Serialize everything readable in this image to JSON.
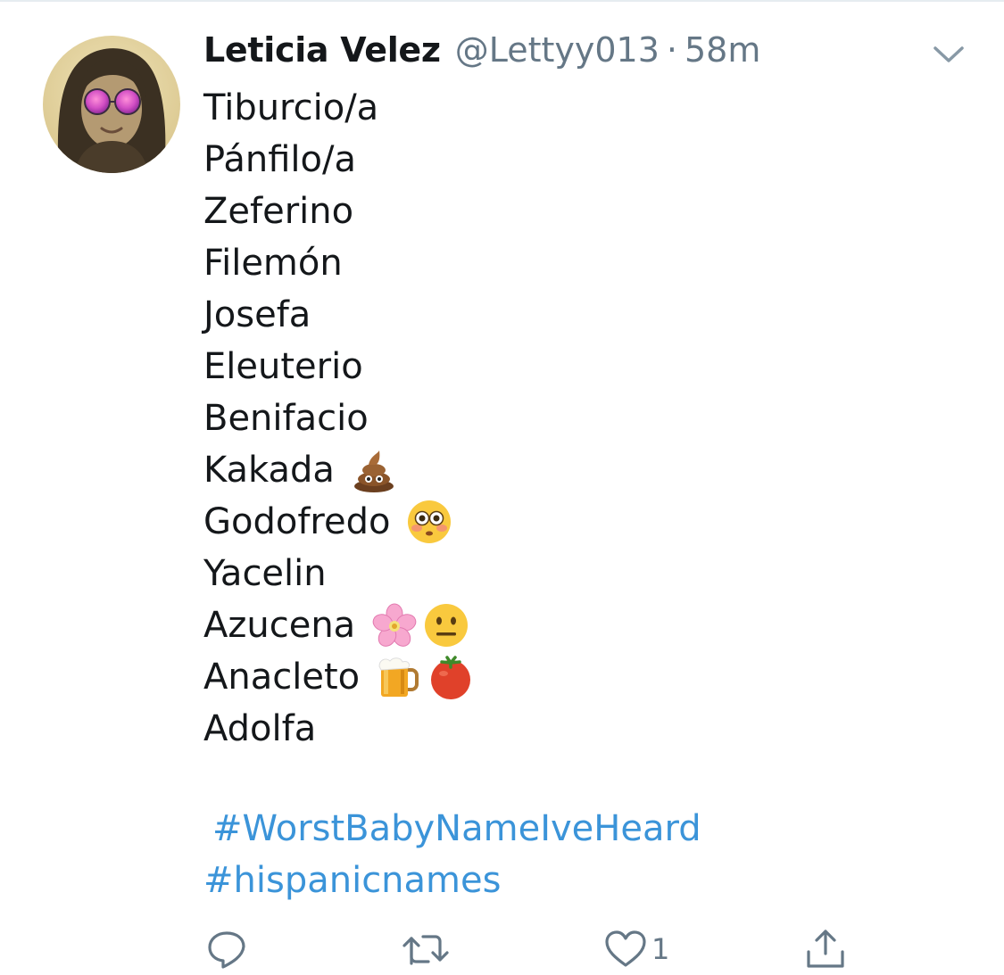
{
  "tweet": {
    "display_name": "Leticia Velez",
    "handle": "@Lettyy013",
    "separator": "·",
    "time": "58m",
    "avatar": "profile-photo-with-pink-round-sunglasses",
    "lines": [
      {
        "text": "Tiburcio/a",
        "emojis": []
      },
      {
        "text": "Pánfilo/a",
        "emojis": []
      },
      {
        "text": "Zeferino",
        "emojis": []
      },
      {
        "text": "Filemón",
        "emojis": []
      },
      {
        "text": "Josefa",
        "emojis": []
      },
      {
        "text": "Eleuterio",
        "emojis": []
      },
      {
        "text": "Benifacio",
        "emojis": []
      },
      {
        "text": "Kakada",
        "emojis": [
          "pile-of-poo-emoji"
        ]
      },
      {
        "text": "Godofredo",
        "emojis": [
          "flushed-face-emoji"
        ]
      },
      {
        "text": "Yacelin",
        "emojis": []
      },
      {
        "text": "Azucena",
        "emojis": [
          "cherry-blossom-emoji",
          "neutral-face-emoji"
        ]
      },
      {
        "text": "Anacleto",
        "emojis": [
          "beer-mug-emoji",
          "tomato-emoji"
        ]
      },
      {
        "text": "Adolfa",
        "emojis": []
      }
    ],
    "hashtags": [
      "#WorstBabyNameIveHeard",
      "#hispanicnames"
    ]
  },
  "actions": {
    "reply_icon": "reply-icon",
    "retweet_icon": "retweet-icon",
    "like_icon": "heart-icon",
    "like_count": "1",
    "share_icon": "share-icon"
  },
  "colors": {
    "text": "#14171a",
    "secondary": "#657786",
    "link": "#3b94d9",
    "divider": "#e6ecf0"
  }
}
